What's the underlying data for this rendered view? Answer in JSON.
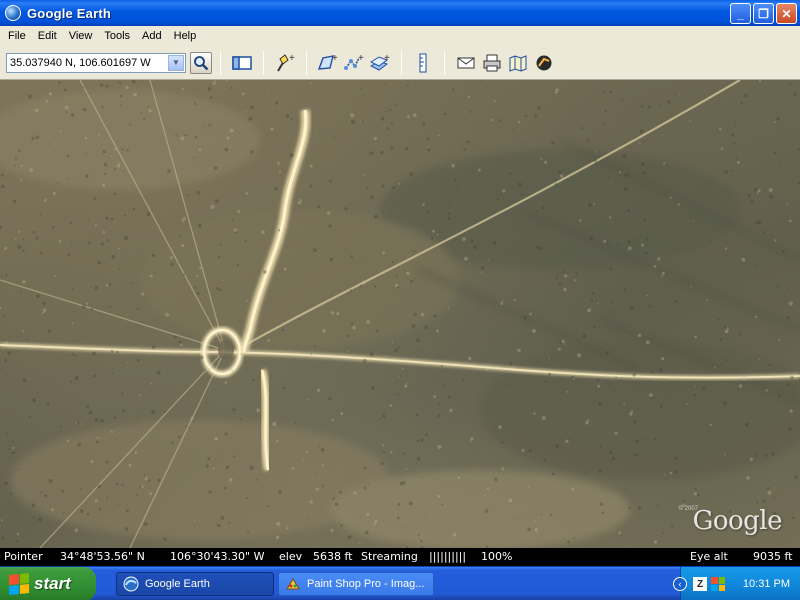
{
  "window": {
    "title": "Google Earth",
    "buttons": [
      "_",
      "❐",
      "✕"
    ]
  },
  "menu": {
    "items": [
      "File",
      "Edit",
      "View",
      "Tools",
      "Add",
      "Help"
    ]
  },
  "toolbar": {
    "coordinates": "35.037940 N, 106.601697 W",
    "icons": [
      "search-icon",
      "sidebar-toggle-icon",
      "placemark-icon",
      "polygon-icon",
      "path-icon",
      "image-overlay-icon",
      "ruler-icon",
      "email-icon",
      "print-icon",
      "maps-icon",
      "sky-icon"
    ]
  },
  "map": {
    "watermark": "Google",
    "copyright": "© 2007"
  },
  "status": {
    "pointer_label": "Pointer",
    "latitude": "34°48'53.56\" N",
    "longitude": "106°30'43.30\" W",
    "elev_label": "elev",
    "elev_value": "5638 ft",
    "streaming_label": "Streaming",
    "streaming_bars": "||||||||||",
    "streaming_pct": "100%",
    "eye_alt_label": "Eye alt",
    "eye_alt_value": "9035 ft"
  },
  "taskbar": {
    "start_label": "start",
    "tasks": [
      {
        "label": "Google Earth",
        "active": true
      },
      {
        "label": "Paint Shop Pro - Imag...",
        "active": false
      }
    ],
    "clock": "10:31 PM"
  },
  "colors": {
    "titlebar": "#0058e0",
    "chrome": "#ece9d8",
    "taskbar": "#245edc",
    "start": "#3c9a3c"
  }
}
